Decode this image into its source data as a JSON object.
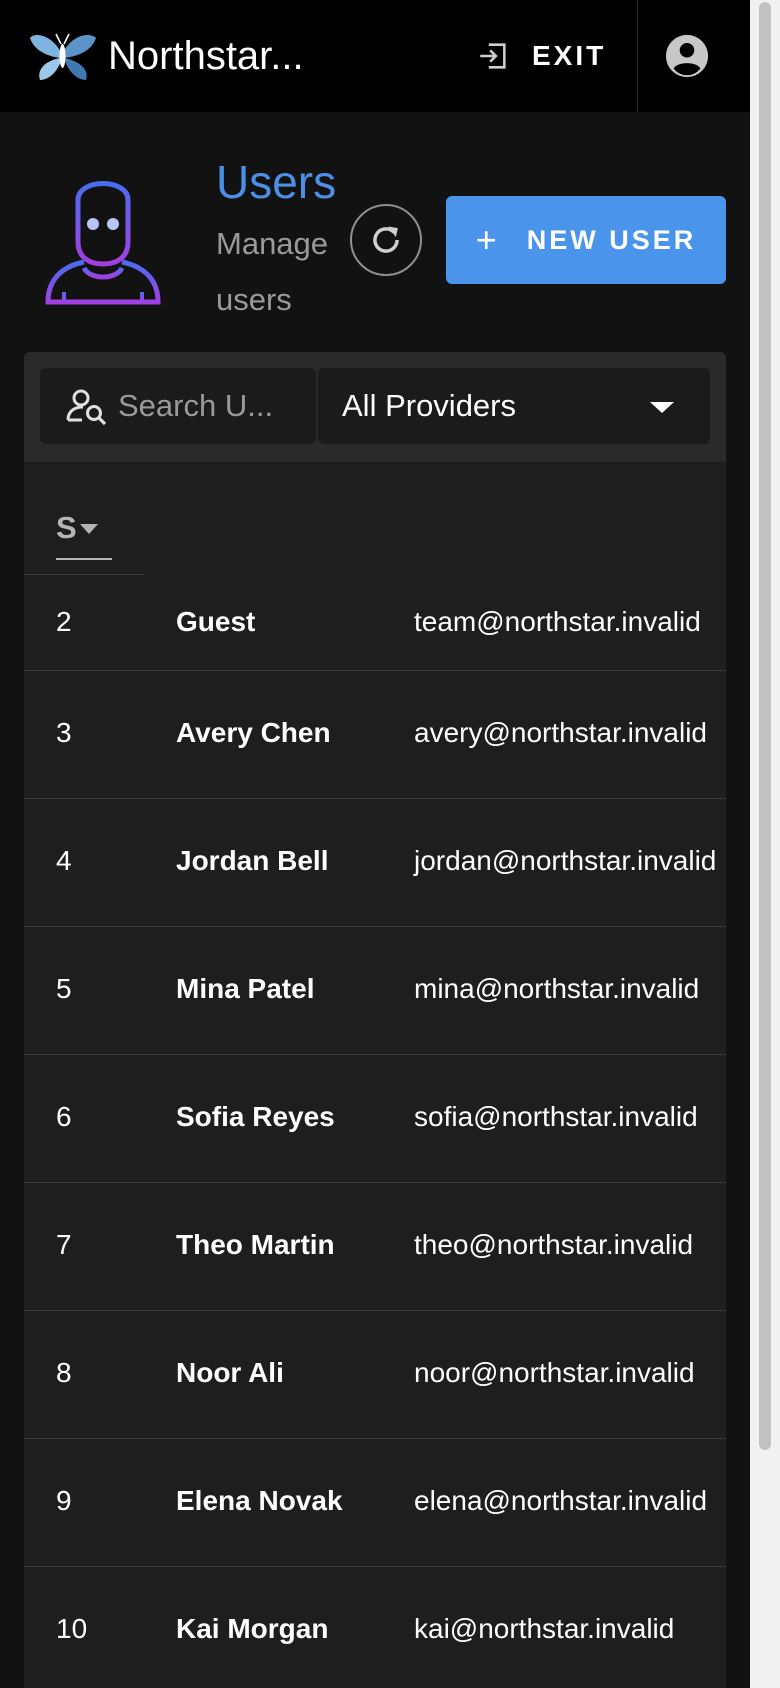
{
  "topbar": {
    "brand": "Northstar...",
    "exit_label": "EXIT",
    "logo_icon": "butterfly-logo-icon",
    "account_icon": "account-circle-icon"
  },
  "header": {
    "title": "Users",
    "subtitle": "Manage users",
    "refresh_icon": "refresh-icon",
    "new_user_plus": "+",
    "new_user_label": "NEW USER"
  },
  "filters": {
    "search_placeholder": "Search U...",
    "provider_selected": "All Providers"
  },
  "table": {
    "sort_column_label": "S",
    "rows": [
      {
        "id": "2",
        "name": "Guest",
        "email": "team@northstar.invalid"
      },
      {
        "id": "3",
        "name": "Avery Chen",
        "email": "avery@northstar.invalid"
      },
      {
        "id": "4",
        "name": "Jordan Bell",
        "email": "jordan@northstar.invalid"
      },
      {
        "id": "5",
        "name": "Mina Patel",
        "email": "mina@northstar.invalid"
      },
      {
        "id": "6",
        "name": "Sofia Reyes",
        "email": "sofia@northstar.invalid"
      },
      {
        "id": "7",
        "name": "Theo Martin",
        "email": "theo@northstar.invalid"
      },
      {
        "id": "8",
        "name": "Noor Ali",
        "email": "noor@northstar.invalid"
      },
      {
        "id": "9",
        "name": "Elena Novak",
        "email": "elena@northstar.invalid"
      },
      {
        "id": "10",
        "name": "Kai Morgan",
        "email": "kai@northstar.invalid"
      }
    ]
  },
  "colors": {
    "accent": "#4a94ec",
    "title": "#4e8fe6",
    "background": "#121212",
    "topbar": "#000000",
    "card": "#1e1e1e"
  }
}
